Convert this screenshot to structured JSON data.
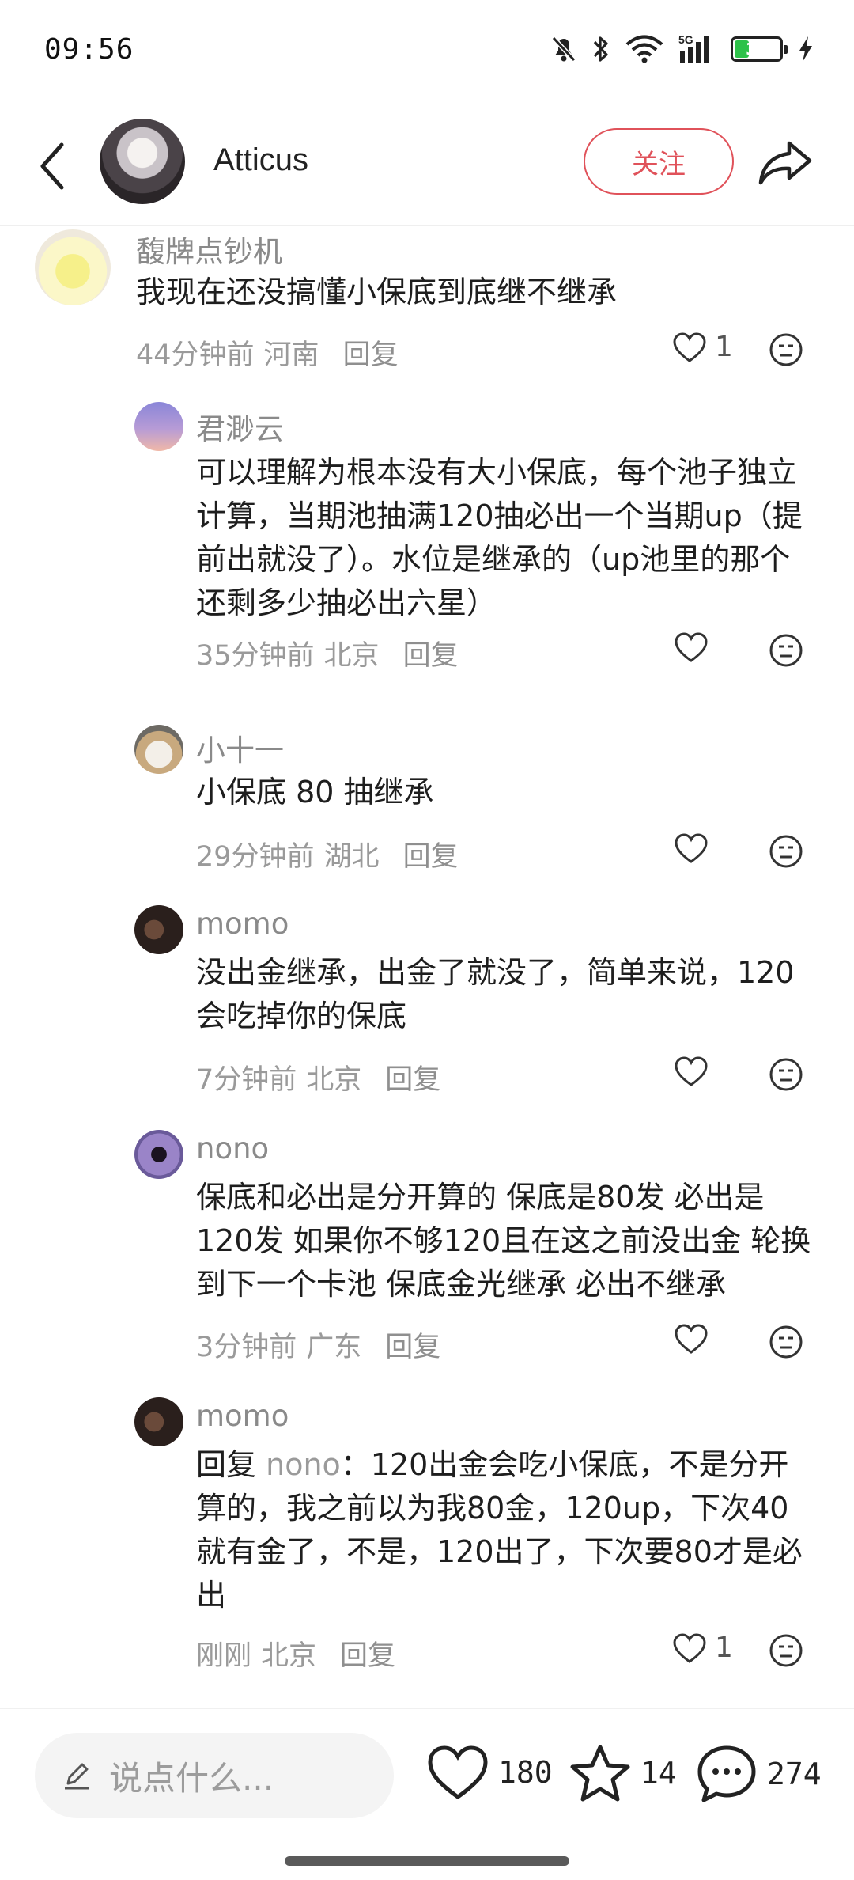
{
  "status_bar": {
    "time": "09:56",
    "battery_level": "37",
    "network": "5G",
    "icons": [
      "mute-icon",
      "bluetooth-icon",
      "wifi-icon",
      "cellular-5g-icon",
      "battery-icon",
      "charging-icon"
    ],
    "battery_color": "#2ec24a"
  },
  "header": {
    "name": "Atticus",
    "follow_label": "关注",
    "accent_color": "#e0525a"
  },
  "comments": [
    {
      "name": "馥牌点钞机",
      "text": "我现在还没搞懂小保底到底继不继承",
      "time": "44分钟前",
      "location": "河南",
      "reply_label": "回复",
      "likes": "1"
    },
    {
      "name": "君渺云",
      "text": "可以理解为根本没有大小保底，每个池子独立计算，当期池抽满120抽必出一个当期up（提前出就没了）。水位是继承的（up池里的那个还剩多少抽必出六星）",
      "time": "35分钟前",
      "location": "北京",
      "reply_label": "回复",
      "likes": ""
    },
    {
      "name": "小十一",
      "text": "小保底 80 抽继承",
      "time": "29分钟前",
      "location": "湖北",
      "reply_label": "回复",
      "likes": ""
    },
    {
      "name": "momo",
      "text": "没出金继承，出金了就没了，简单来说，120会吃掉你的保底",
      "time": "7分钟前",
      "location": "北京",
      "reply_label": "回复",
      "likes": ""
    },
    {
      "name": "nono",
      "text": "保底和必出是分开算的 保底是80发 必出是120发 如果你不够120且在这之前没出金 轮换到下一个卡池 保底金光继承 必出不继承",
      "time": "3分钟前",
      "location": "广东",
      "reply_label": "回复",
      "likes": ""
    },
    {
      "name": "momo",
      "reply_prefix": "回复",
      "reply_to": "nono",
      "text": "：120出金会吃小保底，不是分开算的，我之前以为我80金，120up，下次40就有金了，不是，120出了，下次要80才是必出",
      "time": "刚刚",
      "location": "北京",
      "reply_label": "回复",
      "likes": "1"
    }
  ],
  "bottom_bar": {
    "input_placeholder": "说点什么...",
    "likes": "180",
    "favorites": "14",
    "comments": "274"
  }
}
